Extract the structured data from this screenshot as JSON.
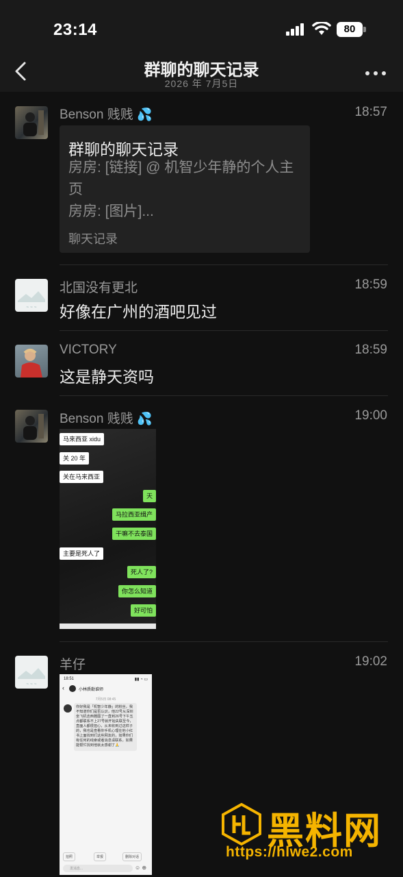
{
  "status": {
    "time": "23:14",
    "battery": "80"
  },
  "header": {
    "title": "群聊的聊天记录",
    "date": "2026 年 7月5日"
  },
  "messages": [
    {
      "sender": "Benson 贱贱",
      "time": "18:57",
      "record": {
        "title": "群聊的聊天记录",
        "line1": "房房: [链接] @ 机智少年静的个人主页",
        "line2": "房房: [图片]...",
        "footer": "聊天记录"
      }
    },
    {
      "sender": "北国没有更北",
      "time": "18:59",
      "text": "好像在广州的酒吧见过"
    },
    {
      "sender": "VICTORY",
      "time": "18:59",
      "text": "这是静天资吗"
    },
    {
      "sender": "Benson 贱贱",
      "time": "19:00",
      "image_bubbles": [
        {
          "side": "left",
          "text": "马来西亚 xidu"
        },
        {
          "side": "left",
          "text": "关 20 年"
        },
        {
          "side": "left",
          "text": "关在马来西亚"
        },
        {
          "side": "right",
          "text": "天"
        },
        {
          "side": "right",
          "text": "马拉西亚缉产"
        },
        {
          "side": "right",
          "text": "干嘛不去泰国"
        },
        {
          "side": "left",
          "text": "主要是死人了"
        },
        {
          "side": "right",
          "text": "死人了?"
        },
        {
          "side": "right",
          "text": "你怎么知道"
        },
        {
          "side": "right",
          "text": "好可怕"
        }
      ]
    },
    {
      "sender": "羊仔",
      "time": "19:02",
      "screenshot": {
        "time": "18:51",
        "name": "小林质勒谁师",
        "date": "7月5日 08:45",
        "text": "你好我是「机智少年静」的粉丝，我不知道你们是否认识，他22号从深圳坐飞机去西雅图了一直到26号下午五点都联系不上27号就开始失联至今，直面人都很担心，从未收到过这样子的，我也是查看你手机心理在他小红书上面找到们这些网友的，如果你们有任何的线索或者消息请联系，如果能帮忙找到他就太感谢了🙏",
        "actions": [
          "拍照",
          "举报",
          "删除对话"
        ],
        "input_placeholder": "发消息..."
      }
    }
  ],
  "watermark": {
    "text": "黑料网",
    "url": "https://hlwe2.com"
  },
  "colors": {
    "background": "#111111",
    "header": "#1a1a1a",
    "accent_blue": "#5ab4ff",
    "watermark": "#f5b400",
    "bubble_green": "#7fe25c"
  }
}
